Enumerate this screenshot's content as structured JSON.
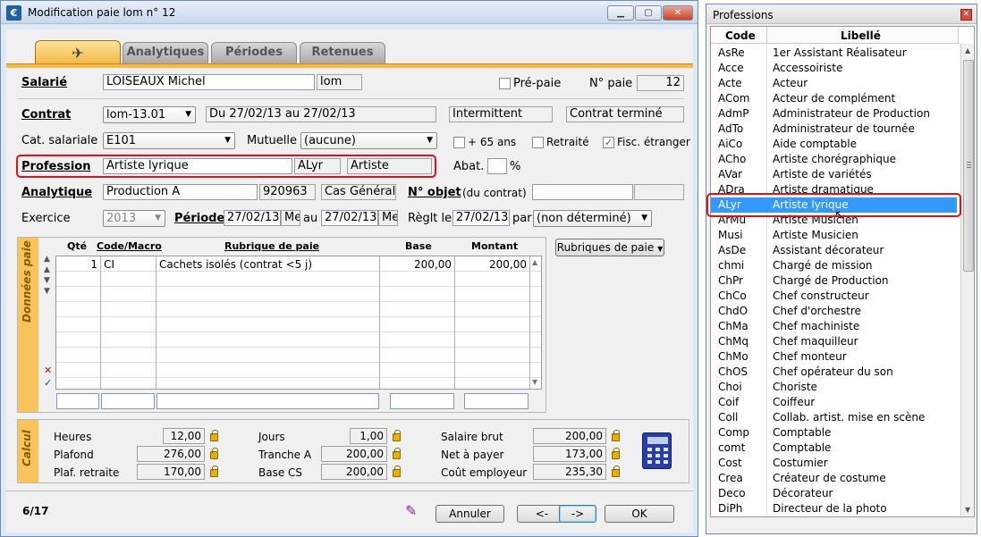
{
  "main_window": {
    "title": "Modification paie lom n° 12",
    "minimize": "▁",
    "maximize": "▢",
    "close": "✕",
    "tabs": [
      "Analytiques",
      "Périodes",
      "Retenues"
    ],
    "salarie": {
      "label": "Salarié",
      "name": "LOISEAUX Michel",
      "code": "lom"
    },
    "prepaie": {
      "label": "Pré-paie",
      "checked": false
    },
    "no_paie": {
      "label": "N° paie",
      "value": "12"
    },
    "contrat": {
      "label": "Contrat",
      "value": "lom-13.01",
      "dates": "Du 27/02/13 au 27/02/13",
      "type": "Intermittent",
      "status": "Contrat terminé"
    },
    "cat_salariale": {
      "label": "Cat. salariale",
      "value": "E101"
    },
    "mutuelle": {
      "label": "Mutuelle",
      "value": "(aucune)"
    },
    "plus65": {
      "label": "+ 65 ans"
    },
    "retraite": {
      "label": "Retraité"
    },
    "fisc": {
      "label": "Fisc. étranger",
      "check": "✓"
    },
    "profession": {
      "label": "Profession",
      "value": "Artiste lyrique",
      "code": "ALyr",
      "cat": "Artiste"
    },
    "abat": {
      "label": "Abat.",
      "unit": "%"
    },
    "analytique": {
      "label": "Analytique",
      "value": "Production A",
      "code": "920963",
      "type": "Cas Général"
    },
    "no_objet": {
      "label": "N° objet",
      "sub": "(du contrat)"
    },
    "exercice": {
      "label": "Exercice",
      "value": "2013"
    },
    "periode": {
      "label": "Période",
      "from": "27/02/13",
      "from_day": "Me",
      "au": "au",
      "to": "27/02/13",
      "to_day": "Me"
    },
    "reglement": {
      "label": "Règlt le",
      "date": "27/02/13",
      "par": "par",
      "mode": "(non déterminé)"
    },
    "donnees_label": "Données paie",
    "rubriques_button": "Rubriques de paie",
    "grid": {
      "headers": [
        "Qté",
        "Code/Macro",
        "Rubrique de paie",
        "Base",
        "Montant"
      ],
      "rows": [
        {
          "qte": "1",
          "code": "CI",
          "rubrique": "Cachets isolés (contrat <5 j)",
          "base": "200,00",
          "montant": "200,00"
        }
      ]
    },
    "calcul_label": "Calcul",
    "calcul": {
      "heures": {
        "label": "Heures",
        "value": "12,00"
      },
      "plafond": {
        "label": "Plafond",
        "value": "276,00"
      },
      "plaf_retraite": {
        "label": "Plaf. retraite",
        "value": "170,00"
      },
      "jours": {
        "label": "Jours",
        "value": "1,00"
      },
      "tranche_a": {
        "label": "Tranche A",
        "value": "200,00"
      },
      "base_cs": {
        "label": "Base CS",
        "value": "200,00"
      },
      "salaire_brut": {
        "label": "Salaire brut",
        "value": "200,00"
      },
      "net_a_payer": {
        "label": "Net à payer",
        "value": "173,00"
      },
      "cout_employeur": {
        "label": "Coût employeur",
        "value": "235,30"
      }
    },
    "footer": {
      "record": "6/17",
      "annuler": "Annuler",
      "prev": "<-",
      "next": "->",
      "ok": "OK"
    }
  },
  "professions_window": {
    "title": "Professions",
    "close": "✕",
    "headers": {
      "code": "Code",
      "libelle": "Libellé"
    },
    "selected_index": 10,
    "items": [
      {
        "code": "AsRe",
        "label": "1er Assistant Réalisateur"
      },
      {
        "code": "Acce",
        "label": "Accessoiriste"
      },
      {
        "code": "Acte",
        "label": "Acteur"
      },
      {
        "code": "ACom",
        "label": "Acteur de complément"
      },
      {
        "code": "AdmP",
        "label": "Administrateur de Production"
      },
      {
        "code": "AdTo",
        "label": "Administrateur de tournée"
      },
      {
        "code": "AiCo",
        "label": "Aide comptable"
      },
      {
        "code": "ACho",
        "label": "Artiste chorégraphique"
      },
      {
        "code": "AVar",
        "label": "Artiste de variétés"
      },
      {
        "code": "ADra",
        "label": "Artiste dramatique"
      },
      {
        "code": "ALyr",
        "label": "Artiste lyrique"
      },
      {
        "code": "ArMu",
        "label": "Artiste Musicien"
      },
      {
        "code": "Musi",
        "label": "Artiste Musicien"
      },
      {
        "code": "AsDe",
        "label": "Assistant décorateur"
      },
      {
        "code": "chmi",
        "label": "Chargé de mission"
      },
      {
        "code": "ChPr",
        "label": "Chargé de Production"
      },
      {
        "code": "ChCo",
        "label": "Chef constructeur"
      },
      {
        "code": "ChdO",
        "label": "Chef d'orchestre"
      },
      {
        "code": "ChMa",
        "label": "Chef machiniste"
      },
      {
        "code": "ChMq",
        "label": "Chef maquilleur"
      },
      {
        "code": "ChMo",
        "label": "Chef monteur"
      },
      {
        "code": "ChOS",
        "label": "Chef opérateur du son"
      },
      {
        "code": "Choi",
        "label": "Choriste"
      },
      {
        "code": "Coif",
        "label": "Coiffeur"
      },
      {
        "code": "Coll",
        "label": "Collab. artist. mise en scène"
      },
      {
        "code": "Comp",
        "label": "Comptable"
      },
      {
        "code": "comt",
        "label": "Comptable"
      },
      {
        "code": "Cost",
        "label": "Costumier"
      },
      {
        "code": "Crea",
        "label": "Créateur de costume"
      },
      {
        "code": "Deco",
        "label": "Décorateur"
      },
      {
        "code": "DiPh",
        "label": "Directeur de la photo"
      }
    ]
  }
}
